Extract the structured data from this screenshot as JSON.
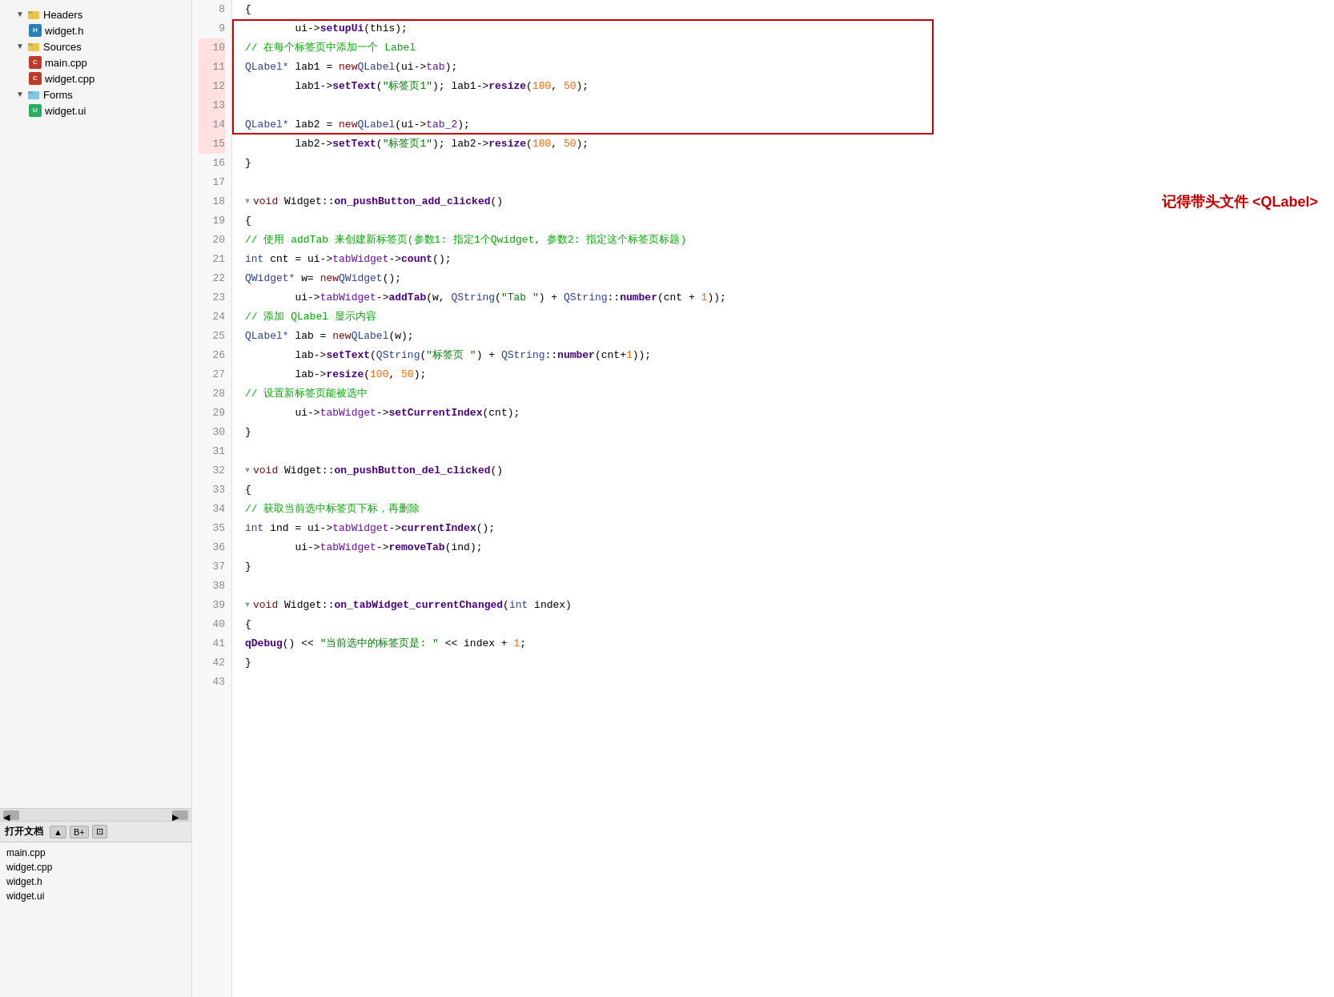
{
  "sidebar": {
    "tree": {
      "items": [
        {
          "id": "headers",
          "label": "Headers",
          "indent": 1,
          "type": "folder",
          "arrow": "▼"
        },
        {
          "id": "widget-h",
          "label": "widget.h",
          "indent": 2,
          "type": "h"
        },
        {
          "id": "sources",
          "label": "Sources",
          "indent": 1,
          "type": "folder-open",
          "arrow": "▼"
        },
        {
          "id": "main-cpp",
          "label": "main.cpp",
          "indent": 2,
          "type": "cpp"
        },
        {
          "id": "widget-cpp",
          "label": "widget.cpp",
          "indent": 2,
          "type": "cpp"
        },
        {
          "id": "forms",
          "label": "Forms",
          "indent": 1,
          "type": "folder",
          "arrow": "▼"
        },
        {
          "id": "widget-ui",
          "label": "widget.ui",
          "indent": 2,
          "type": "ui"
        }
      ]
    },
    "bottom": {
      "toolbar_label": "打开文档",
      "files": [
        {
          "name": "main.cpp"
        },
        {
          "name": "widget.cpp"
        },
        {
          "name": "widget.h"
        },
        {
          "name": "widget.ui"
        }
      ]
    }
  },
  "code": {
    "annotation": "记得带头文件 <QLabel>",
    "lines": [
      {
        "num": 8,
        "content_html": "    {"
      },
      {
        "num": 9,
        "content_html": "        ui-><span class='c-func2'>setupUi</span>(this);"
      },
      {
        "num": 10,
        "content_html": "        <span class='c-comment'>// 在每个标签页中添加一个 Label</span>"
      },
      {
        "num": 11,
        "content_html": "        <span class='c-type'>QLabel*</span> lab1 = <span class='c-keyword'>new</span> <span class='c-type'>QLabel</span>(ui-><span class='c-violet'>tab</span>);"
      },
      {
        "num": 12,
        "content_html": "        lab1-><span class='c-func2'>setText</span>(<span class='c-string'>\"标签页1\"</span>); lab1-><span class='c-func2'>resize</span>(<span class='c-number'>100</span>, <span class='c-number'>50</span>);"
      },
      {
        "num": 13,
        "content_html": ""
      },
      {
        "num": 14,
        "content_html": "        <span class='c-type'>QLabel*</span> lab2 = <span class='c-keyword'>new</span> <span class='c-type'>QLabel</span>(ui-><span class='c-violet'>tab_2</span>);"
      },
      {
        "num": 15,
        "content_html": "        lab2-><span class='c-func2'>setText</span>(<span class='c-string'>\"标签页1\"</span>); lab2-><span class='c-func2'>resize</span>(<span class='c-number'>100</span>, <span class='c-number'>50</span>);"
      },
      {
        "num": 16,
        "content_html": "    }"
      },
      {
        "num": 17,
        "content_html": ""
      },
      {
        "num": 18,
        "content_html": "<span class='fold-arrow'>▼</span><span class='c-keyword'>void</span> Widget::<span class='c-bold-func'>on_pushButton_add_clicked</span>()"
      },
      {
        "num": 19,
        "content_html": "    {"
      },
      {
        "num": 20,
        "content_html": "        <span class='c-comment'>// 使用 addTab 来创建新标签页(参数1: 指定1个Qwidget, 参数2: 指定这个标签页标题)</span>"
      },
      {
        "num": 21,
        "content_html": "        <span class='c-type'>int</span> cnt = ui-><span class='c-violet'>tabWidget</span>-><span class='c-func2'>count</span>();"
      },
      {
        "num": 22,
        "content_html": "        <span class='c-type'>QWidget*</span> w= <span class='c-keyword'>new</span> <span class='c-type'>QWidget</span>();"
      },
      {
        "num": 23,
        "content_html": "        ui-><span class='c-violet'>tabWidget</span>-><span class='c-func2'>addTab</span>(w, <span class='c-type'>QString</span>(<span class='c-string'>\"Tab \"</span>) + <span class='c-type'>QString</span>::<span class='c-func2'>number</span>(cnt + <span class='c-number'>1</span>));"
      },
      {
        "num": 24,
        "content_html": "        <span class='c-comment'>// 添加 QLabel 显示内容</span>"
      },
      {
        "num": 25,
        "content_html": "        <span class='c-type'>QLabel*</span> lab = <span class='c-keyword'>new</span> <span class='c-type'>QLabel</span>(w);"
      },
      {
        "num": 26,
        "content_html": "        lab-><span class='c-func2'>setText</span>(<span class='c-type'>QString</span>(<span class='c-string'>\"标签页 \"</span>) + <span class='c-type'>QString</span>::<span class='c-func2'>number</span>(cnt+<span class='c-number'>1</span>));"
      },
      {
        "num": 27,
        "content_html": "        lab-><span class='c-func2'>resize</span>(<span class='c-number'>100</span>, <span class='c-number'>50</span>);"
      },
      {
        "num": 28,
        "content_html": "        <span class='c-comment'>// 设置新标签页能被选中</span>"
      },
      {
        "num": 29,
        "content_html": "        ui-><span class='c-violet'>tabWidget</span>-><span class='c-func2'>setCurrentIndex</span>(cnt);"
      },
      {
        "num": 30,
        "content_html": "    }"
      },
      {
        "num": 31,
        "content_html": ""
      },
      {
        "num": 32,
        "content_html": "<span class='fold-arrow'>▼</span><span class='c-keyword'>void</span> Widget::<span class='c-bold-func'>on_pushButton_del_clicked</span>()"
      },
      {
        "num": 33,
        "content_html": "    {"
      },
      {
        "num": 34,
        "content_html": "        <span class='c-comment'>// 获取当前选中标签页下标，再删除</span>"
      },
      {
        "num": 35,
        "content_html": "        <span class='c-type'>int</span> ind = ui-><span class='c-violet'>tabWidget</span>-><span class='c-func2'>currentIndex</span>();"
      },
      {
        "num": 36,
        "content_html": "        ui-><span class='c-violet'>tabWidget</span>-><span class='c-func2'>removeTab</span>(ind);"
      },
      {
        "num": 37,
        "content_html": "    }"
      },
      {
        "num": 38,
        "content_html": ""
      },
      {
        "num": 39,
        "content_html": "<span class='fold-arrow'>▼</span><span class='c-keyword'>void</span> Widget::<span class='c-bold-func'>on_tabWidget_currentChanged</span>(<span class='c-type'>int</span> index)"
      },
      {
        "num": 40,
        "content_html": "    {"
      },
      {
        "num": 41,
        "content_html": "        <span class='c-func2'>qDebug</span>() &lt;&lt; <span class='c-string'>\"当前选中的标签页是: \"</span> &lt;&lt; index + <span class='c-number'>1</span>;"
      },
      {
        "num": 42,
        "content_html": "    }"
      },
      {
        "num": 43,
        "content_html": ""
      }
    ]
  }
}
